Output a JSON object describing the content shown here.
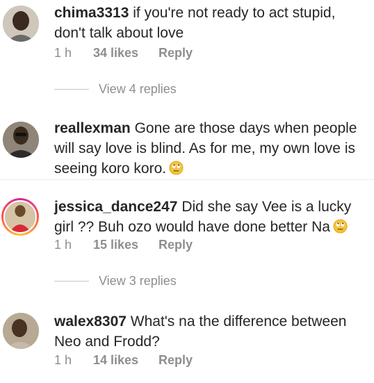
{
  "comments": [
    {
      "username": "chima3313",
      "text": "if you're not ready to act stupid, don't talk about love",
      "time": "1 h",
      "likes": "34 likes",
      "reply": "Reply",
      "view_replies": "View 4 replies"
    },
    {
      "username": "reallexman",
      "text": "Gone are those days when people will say love is blind. As for me, my own love is seeing koro koro."
    },
    {
      "username": "jessica_dance247",
      "text": "Did she say Vee is a lucky girl ?? Buh ozo would have done better Na",
      "time": "1 h",
      "likes": "15 likes",
      "reply": "Reply",
      "view_replies": "View 3 replies"
    },
    {
      "username": "walex8307",
      "text": "What's na the difference between Neo and Frodd?",
      "time": "1 h",
      "likes": "14 likes",
      "reply": "Reply"
    }
  ],
  "icons": {
    "emoji": "face-with-rolling-eyes-emoji"
  }
}
